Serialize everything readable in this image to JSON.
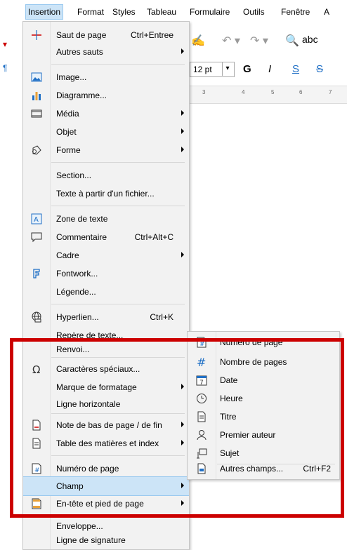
{
  "menubar": [
    {
      "label": "Insertion",
      "active": true
    },
    {
      "label": "Format"
    },
    {
      "label": "Styles"
    },
    {
      "label": "Tableau"
    },
    {
      "label": "Formulaire"
    },
    {
      "label": "Outils"
    },
    {
      "label": "Fenêtre"
    },
    {
      "label": "A"
    }
  ],
  "toolbar": {
    "font_size": "12 pt",
    "bold": "G",
    "italic": "I",
    "underline": "S",
    "strike": "S",
    "spell": "abc",
    "ruler_ticks": [
      "3",
      "4",
      "5",
      "6",
      "7"
    ]
  },
  "menu": {
    "items": [
      {
        "label": "Saut de page",
        "shortcut": "Ctrl+Entree",
        "icon": "page-break-icon"
      },
      {
        "label": "Autres sauts",
        "submenu": true
      },
      {
        "label": "Image...",
        "icon": "image-icon"
      },
      {
        "label": "Diagramme...",
        "icon": "chart-icon"
      },
      {
        "label": "Média",
        "submenu": true,
        "icon": "media-icon"
      },
      {
        "label": "Objet",
        "submenu": true
      },
      {
        "label": "Forme",
        "submenu": true,
        "icon": "shape-icon"
      },
      {
        "label": "Section..."
      },
      {
        "label": "Texte à partir d'un fichier..."
      },
      {
        "label": "Zone de texte",
        "icon": "text-box-icon"
      },
      {
        "label": "Commentaire",
        "shortcut": "Ctrl+Alt+C",
        "icon": "comment-icon"
      },
      {
        "label": "Cadre",
        "submenu": true
      },
      {
        "label": "Fontwork...",
        "icon": "fontwork-icon"
      },
      {
        "label": "Légende..."
      },
      {
        "label": "Hyperlien...",
        "shortcut": "Ctrl+K",
        "icon": "hyperlink-icon"
      },
      {
        "label": "Repère de texte..."
      },
      {
        "label": "Renvoi..."
      },
      {
        "label": "Caractères spéciaux...",
        "icon": "omega-icon"
      },
      {
        "label": "Marque de formatage",
        "submenu": true
      },
      {
        "label": "Ligne horizontale"
      },
      {
        "label": "Note de bas de page / de fin",
        "submenu": true,
        "icon": "footnote-icon"
      },
      {
        "label": "Table des matières et index",
        "submenu": true,
        "icon": "toc-icon"
      },
      {
        "label": "Numéro de page",
        "icon": "page-number-icon"
      },
      {
        "label": "Champ",
        "submenu": true,
        "highlighted": true
      },
      {
        "label": "En-tête et pied de page",
        "submenu": true,
        "icon": "header-footer-icon"
      },
      {
        "label": "Enveloppe..."
      },
      {
        "label": "Ligne de signature"
      }
    ]
  },
  "submenu": {
    "items": [
      {
        "label": "Numéro de page",
        "icon": "page-number-icon"
      },
      {
        "label": "Nombre de pages",
        "icon": "page-count-icon"
      },
      {
        "label": "Date",
        "icon": "calendar-icon"
      },
      {
        "label": "Heure",
        "icon": "clock-icon"
      },
      {
        "label": "Titre",
        "icon": "title-icon"
      },
      {
        "label": "Premier auteur",
        "icon": "author-icon"
      },
      {
        "label": "Sujet",
        "icon": "subject-icon"
      },
      {
        "label": "Autres champs...",
        "shortcut": "Ctrl+F2",
        "icon": "more-fields-icon"
      }
    ]
  },
  "colors": {
    "highlight": "#cce4f7",
    "annotation_red": "#cc0000",
    "icon_blue": "#1f6fc5"
  }
}
